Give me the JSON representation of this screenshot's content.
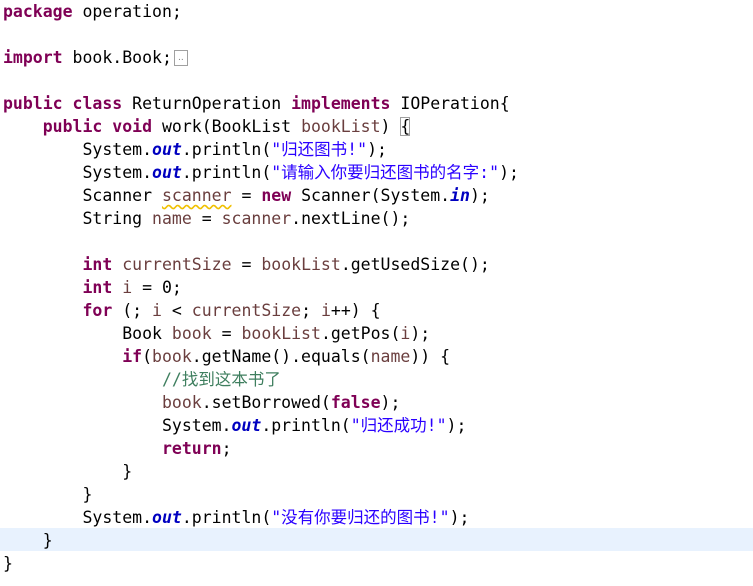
{
  "editor": {
    "fold_marker": "..",
    "lines": {
      "l1": {
        "kw": "package",
        "rest": " operation;"
      },
      "l3": {
        "kw": "import",
        "rest": " book.Book;"
      },
      "l5": {
        "kw1": "public",
        "kw2": "class",
        "name": " ReturnOperation ",
        "kw3": "implements",
        "rest": " IOPeration{"
      },
      "l6": {
        "kw1": "public",
        "kw2": "void",
        "pre": " work(BookList ",
        "param": "bookList",
        "mid": ") ",
        "brace": "{"
      },
      "l7": {
        "pre": "System.",
        "field": "out",
        "mid": ".println(",
        "str": "\"归还图书!\"",
        "end": ");"
      },
      "l8": {
        "pre": "System.",
        "field": "out",
        "mid": ".println(",
        "str": "\"请输入你要归还图书的名字:\"",
        "end": ");"
      },
      "l9": {
        "pre": "Scanner ",
        "var": "scanner",
        "mid": " = ",
        "kw": "new",
        "mid2": " Scanner(System.",
        "field": "in",
        "end": ");"
      },
      "l10": {
        "pre": "String ",
        "var1": "name",
        "mid": " = ",
        "var2": "scanner",
        "end": ".nextLine();"
      },
      "l12": {
        "kw": "int",
        "sp": " ",
        "var1": "currentSize",
        "mid": " = ",
        "var2": "bookList",
        "end": ".getUsedSize();"
      },
      "l13": {
        "kw": "int",
        "sp": " ",
        "var": "i",
        "end": " = 0;"
      },
      "l14": {
        "kw": "for",
        "p1": " (; ",
        "v1": "i",
        "p2": " < ",
        "v2": "currentSize",
        "p3": "; ",
        "v3": "i",
        "p4": "++) {"
      },
      "l15": {
        "pre": "Book ",
        "v1": "book",
        "mid": " = ",
        "v2": "bookList",
        "mid2": ".getPos(",
        "v3": "i",
        "end": ");"
      },
      "l16": {
        "kw": "if",
        "p1": "(",
        "v1": "book",
        "p2": ".getName().equals(",
        "v2": "name",
        "p3": ")) {"
      },
      "l17": {
        "comment": "//找到这本书了"
      },
      "l18": {
        "v": "book",
        "mid": ".setBorrowed(",
        "kw": "false",
        "end": ");"
      },
      "l19": {
        "pre": "System.",
        "field": "out",
        "mid": ".println(",
        "str": "\"归还成功!\"",
        "end": ");"
      },
      "l20": {
        "kw": "return",
        "end": ";"
      },
      "l21": {
        "text": "}"
      },
      "l22": {
        "text": "}"
      },
      "l23": {
        "pre": "System.",
        "field": "out",
        "mid": ".println(",
        "str": "\"没有你要归还的图书!\"",
        "end": ");"
      },
      "l24": {
        "text": "}"
      },
      "l25": {
        "text": "}"
      }
    }
  }
}
